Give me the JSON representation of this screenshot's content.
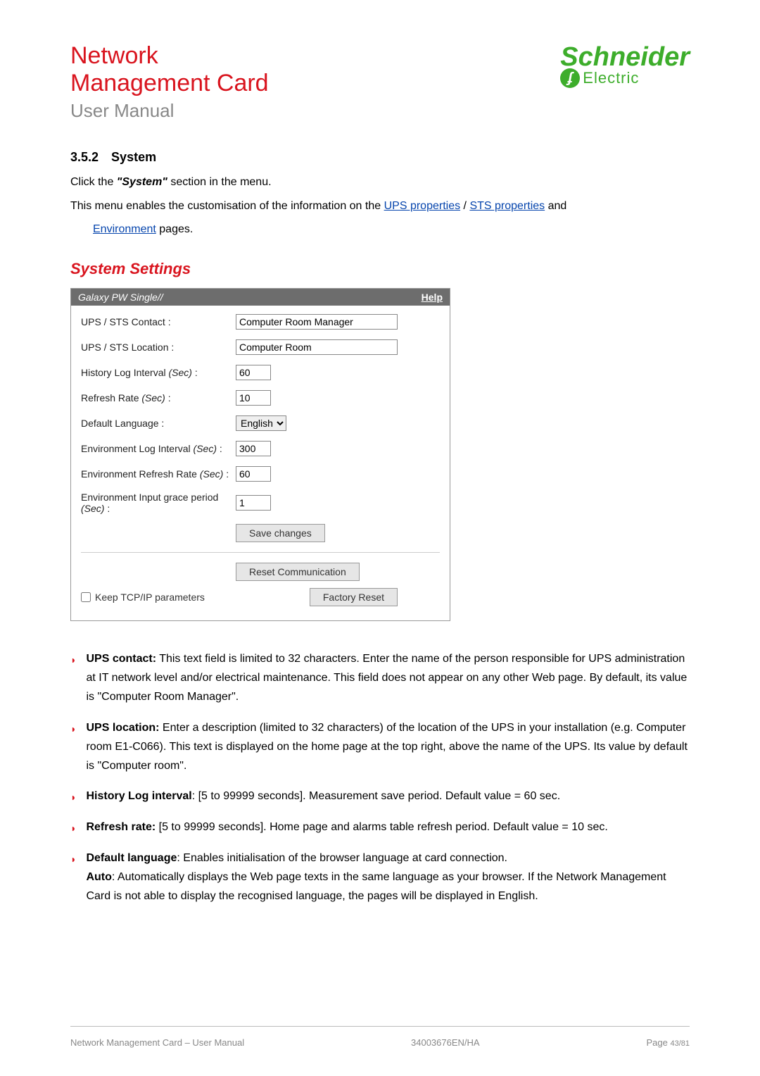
{
  "header": {
    "title_line1": "Network",
    "title_line2": "Management Card",
    "subtitle": "User Manual",
    "logo_top": "Schneider",
    "logo_bottom": "Electric"
  },
  "section": {
    "number": "3.5.2",
    "title": "System",
    "line1_a": "Click the ",
    "line1_b": "\"System\"",
    "line1_c": " section in the menu.",
    "line2_a": "This menu enables the customisation of the information on the ",
    "line2_link1": "UPS properties",
    "line2_b": "  / ",
    "line2_link2": "STS properties",
    "line2_c": " and",
    "line3_link": "Environment",
    "line3_a": " pages."
  },
  "panel": {
    "title": "System Settings",
    "device": "Galaxy PW Single//",
    "help": "Help",
    "rows": {
      "contact_label": "UPS / STS Contact :",
      "contact_value": "Computer Room Manager",
      "location_label": "UPS / STS Location :",
      "location_value": "Computer Room",
      "history_label_a": "History Log Interval ",
      "history_label_b": "(Sec)",
      "history_label_c": " :",
      "history_value": "60",
      "refresh_label_a": "Refresh Rate ",
      "refresh_label_b": "(Sec)",
      "refresh_label_c": " :",
      "refresh_value": "10",
      "lang_label": "Default Language :",
      "lang_value": "English",
      "envlog_label_a": "Environment Log Interval ",
      "envlog_label_b": "(Sec)",
      "envlog_label_c": " :",
      "envlog_value": "300",
      "envref_label_a": "Environment Refresh Rate ",
      "envref_label_b": "(Sec)",
      "envref_label_c": " :",
      "envref_value": "60",
      "grace_label_a": "Environment Input grace period ",
      "grace_label_b": "(Sec)",
      "grace_label_c": " :",
      "grace_value": "1"
    },
    "save_btn": "Save changes",
    "reset_comm_btn": "Reset Communication",
    "factory_btn": "Factory Reset",
    "keep_tcpip": "Keep TCP/IP parameters"
  },
  "bullets": {
    "b1_title": "UPS contact:",
    "b1_text": " This text field is limited to 32 characters. Enter the name of the person responsible for UPS administration at IT network level and/or electrical maintenance. This field does not appear on any other Web page. By default, its value is \"Computer Room Manager\".",
    "b2_title": "UPS location:",
    "b2_text": " Enter a description (limited to 32 characters) of the location of the UPS in your installation (e.g. Computer room E1-C066). This text is displayed on the home page at the top right, above the name of the UPS. Its value by default is \"Computer room\".",
    "b3_title": "History Log interval",
    "b3_text": ": [5 to 99999 seconds]. Measurement save period. Default value = 60 sec.",
    "b4_title": "Refresh rate:",
    "b4_text": " [5 to 99999 seconds]. Home page and alarms table refresh period. Default value = 10 sec.",
    "b5_title": "Default language",
    "b5_text": ": Enables initialisation of the browser language at card connection.",
    "b5_auto_title": "Auto",
    "b5_auto_text": ": Automatically displays the Web page texts in the same language as your browser. If the Network Management Card is not able to display the recognised language, the pages will be displayed in English."
  },
  "footer": {
    "left_a": "Network Management Card",
    "left_b": " – User Manual",
    "center": "34003676EN/HA",
    "right_a": "Page ",
    "right_b": "43/81"
  }
}
